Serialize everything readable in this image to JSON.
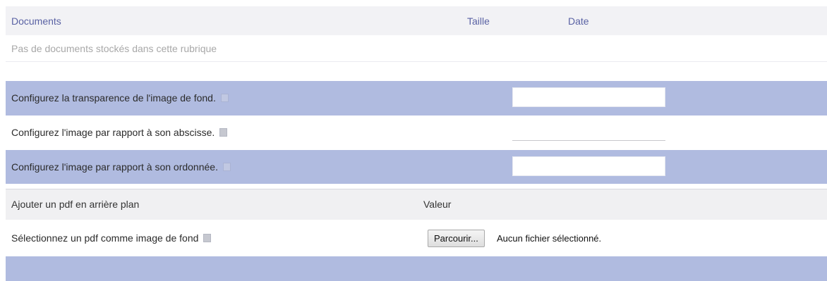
{
  "documents": {
    "headers": {
      "name": "Documents",
      "size": "Taille",
      "date": "Date"
    },
    "empty_message": "Pas de documents stockés dans cette rubrique"
  },
  "config": {
    "transparency_label": "Configurez la transparence de l'image de fond.",
    "abscissa_label": "Configurez l'image par rapport à son abscisse.",
    "ordinate_label": "Configurez l'image par rapport à son ordonnée.",
    "transparency_value": "",
    "abscissa_value": "",
    "ordinate_value": ""
  },
  "pdf": {
    "header_label": "Ajouter un pdf en arrière plan",
    "header_value": "Valeur",
    "select_label": "Sélectionnez un pdf comme image de fond",
    "browse_label": "Parcourir...",
    "file_status": "Aucun fichier sélectionné."
  },
  "colors": {
    "band": "#b0bbe0",
    "header_text": "#5a62a4"
  }
}
